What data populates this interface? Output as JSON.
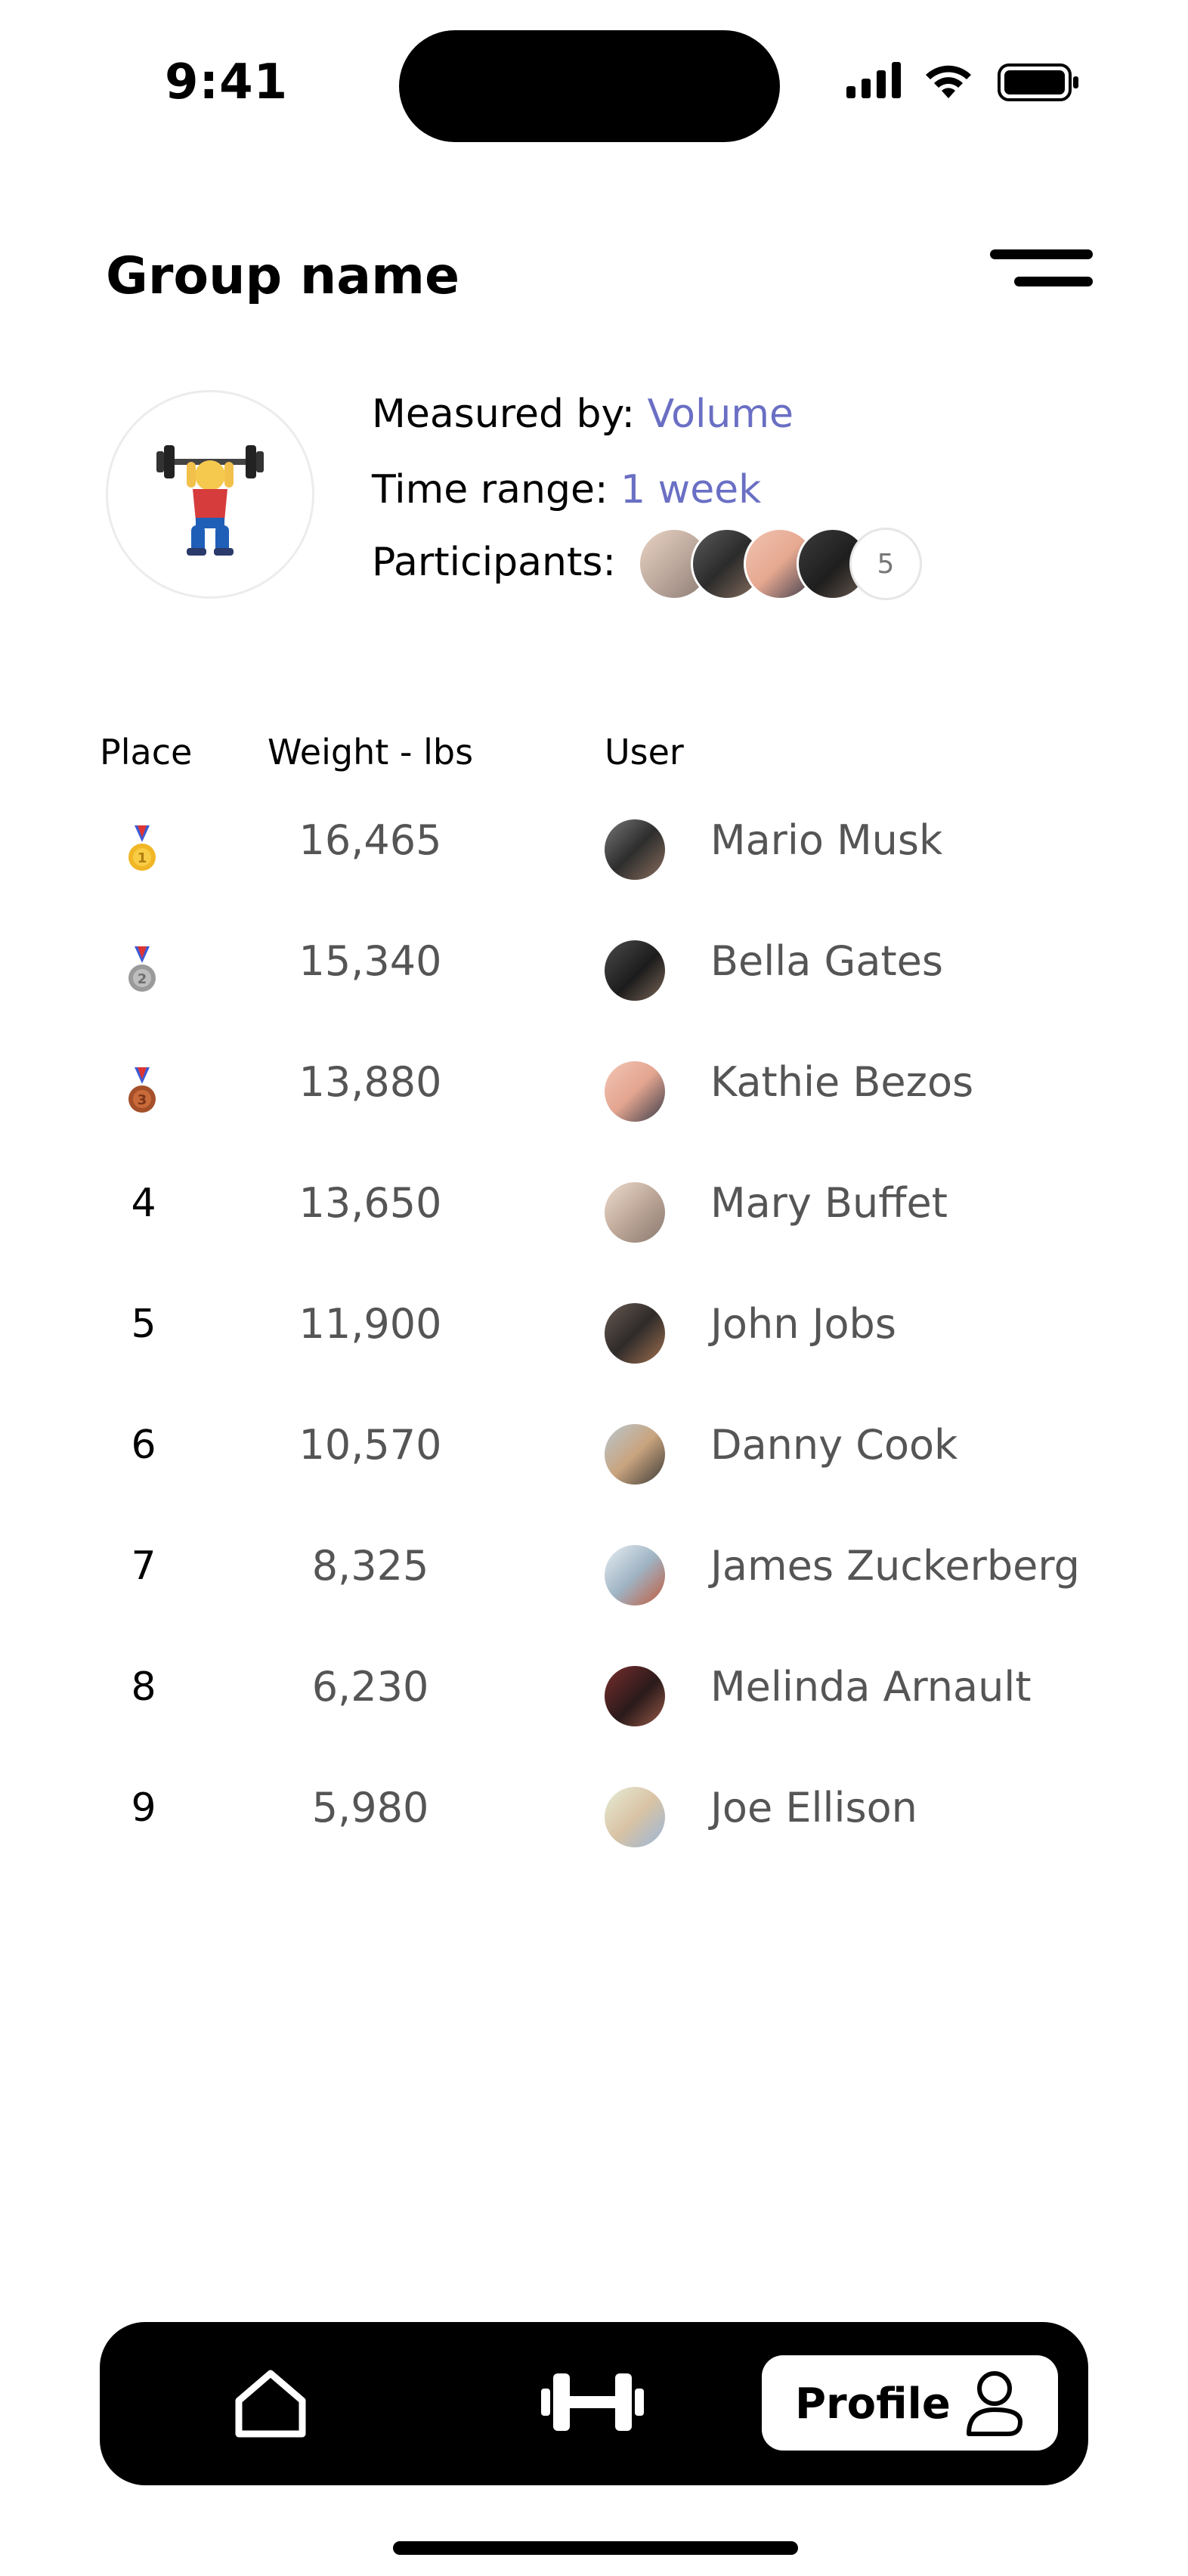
{
  "status_bar": {
    "time": "9:41"
  },
  "header": {
    "title": "Group name"
  },
  "group_info": {
    "measured_label": "Measured by: ",
    "measured_value": "Volume",
    "time_label": "Time range: ",
    "time_value": "1 week",
    "participants_label": "Participants:",
    "participants_extra": "5"
  },
  "table": {
    "headers": {
      "place": "Place",
      "weight": "Weight - lbs",
      "user": "User"
    },
    "rows": [
      {
        "place": "1",
        "weight": "16,465",
        "user": "Mario Musk",
        "medal": "gold"
      },
      {
        "place": "2",
        "weight": "15,340",
        "user": "Bella Gates",
        "medal": "silver"
      },
      {
        "place": "3",
        "weight": "13,880",
        "user": "Kathie Bezos",
        "medal": "bronze"
      },
      {
        "place": "4",
        "weight": "13,650",
        "user": "Mary Buffet"
      },
      {
        "place": "5",
        "weight": "11,900",
        "user": "John Jobs"
      },
      {
        "place": "6",
        "weight": "10,570",
        "user": "Danny Cook"
      },
      {
        "place": "7",
        "weight": "8,325",
        "user": "James Zuckerberg"
      },
      {
        "place": "8",
        "weight": "6,230",
        "user": "Melinda Arnault"
      },
      {
        "place": "9",
        "weight": "5,980",
        "user": "Joe Ellison"
      }
    ]
  },
  "bottom_nav": {
    "profile_label": "Profile",
    "icons": [
      "home-icon",
      "dumbbell-icon",
      "user-icon"
    ]
  },
  "colors": {
    "accent": "#6a6fc4",
    "text_muted": "#555555"
  }
}
